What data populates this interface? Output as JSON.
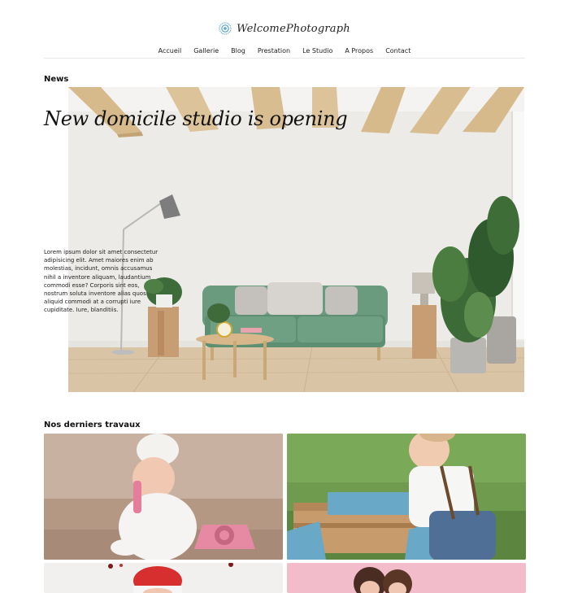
{
  "header": {
    "brand_name": "WelcomePhotograph",
    "brand_icon": "aperture-icon"
  },
  "nav": {
    "items": [
      {
        "label": "Accueil"
      },
      {
        "label": "Gallerie"
      },
      {
        "label": "Blog"
      },
      {
        "label": "Prestation"
      },
      {
        "label": "Le Studio"
      },
      {
        "label": "A Propos"
      },
      {
        "label": "Contact"
      }
    ]
  },
  "news": {
    "section_title": "News",
    "headline": "New domicile studio is opening",
    "body": "Lorem ipsum dolor sit amet consectetur adipisicing elit. Amet maiores enim ab molestias, incidunt, omnis accusamus nihil a inventore aliquam, laudantium commodi esse? Corporis sint eos, nostrum soluta inventore alias quos aliquid commodi at a corrupti iure cupiditate. Iure, blanditiis."
  },
  "works": {
    "section_title": "Nos derniers travaux",
    "tiles": [
      {
        "name": "baby-with-pink-phone-photo"
      },
      {
        "name": "toddler-outdoor-photo"
      },
      {
        "name": "christmas-baby-photo"
      },
      {
        "name": "sisters-pink-backdrop-photo"
      }
    ]
  },
  "colors": {
    "sofa_green": "#6b9b7e",
    "wood_beam": "#d8bf95",
    "wall": "#ecebe8",
    "floor": "#d9c4a6",
    "pink_backdrop": "#f3bccb"
  }
}
